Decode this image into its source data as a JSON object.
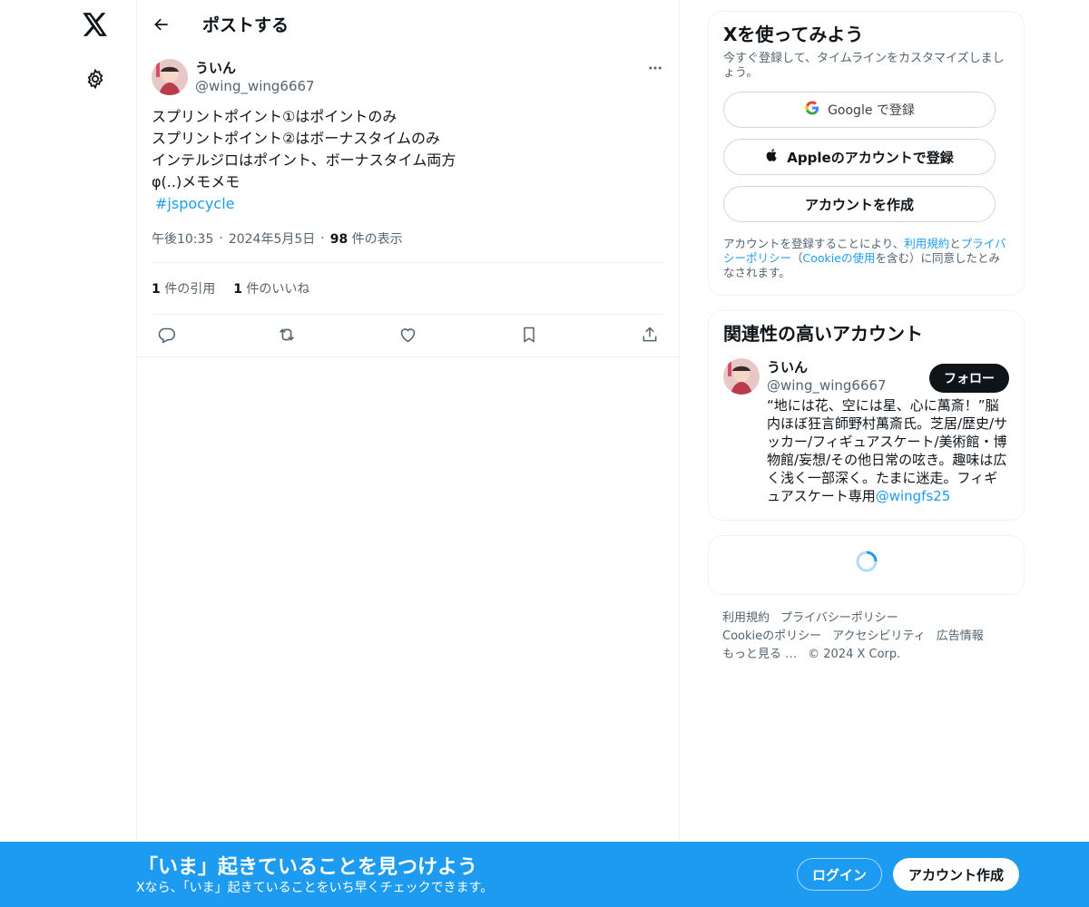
{
  "header": {
    "title": "ポストする"
  },
  "post": {
    "author_name": "ういん",
    "author_handle": "@wing_wing6667",
    "lines": [
      "スプリントポイント①はポイントのみ",
      "スプリントポイント②はボーナスタイムのみ",
      "インテルジロはポイント、ボーナスタイム両方",
      "φ(..)メモメモ"
    ],
    "hashtag": "#jspocycle",
    "time": "午後10:35",
    "date": "2024年5月5日",
    "views_count": "98",
    "views_label": "件の表示",
    "quotes_count": "1",
    "quotes_label": "件の引用",
    "likes_count": "1",
    "likes_label": "件のいいね"
  },
  "signup_card": {
    "title": "Xを使ってみよう",
    "subtitle": "今すぐ登録して、タイムラインをカスタマイズしましょう。",
    "google_label": "Google で登録",
    "apple_label": "Appleのアカウントで登録",
    "create_label": "アカウントを作成",
    "terms_prefix": "アカウントを登録することにより、",
    "terms_link": "利用規約",
    "terms_and": "と",
    "privacy_link": "プライバシーポリシー",
    "terms_mid": "（",
    "cookie_link": "Cookieの使用",
    "terms_suffix": "を含む）に同意したとみなされます。"
  },
  "related_card": {
    "title": "関連性の高いアカウント",
    "name": "ういん",
    "handle": "@wing_wing6667",
    "follow_label": "フォロー",
    "bio": "“地には花、空には星、心に萬斎！”脳内ほぼ狂言師野村萬斎氏。芝居/歴史/サッカー/フィギュアスケート/美術館・博物館/妄想/その他日常の呟き。趣味は広く浅く一部深く。たまに迷走。フィギュアスケート専用",
    "bio_link": "@wingfs25"
  },
  "footer": {
    "links": [
      "利用規約",
      "プライバシーポリシー",
      "Cookieのポリシー",
      "アクセシビリティ",
      "広告情報",
      "もっと見る …"
    ],
    "copyright": "© 2024 X Corp."
  },
  "banner": {
    "title": "「いま」起きていることを見つけよう",
    "subtitle": "Xなら、「いま」起きていることをいち早くチェックできます。",
    "login_label": "ログイン",
    "signup_label": "アカウント作成"
  },
  "colors": {
    "accent": "#1d9bf0",
    "text": "#0f1419",
    "muted": "#536471"
  },
  "icons": [
    "x-logo-icon",
    "gear-icon",
    "arrow-left-icon",
    "more-icon",
    "reply-icon",
    "repost-icon",
    "like-icon",
    "bookmark-icon",
    "share-icon",
    "google-icon",
    "apple-icon",
    "loading-spinner-icon"
  ]
}
